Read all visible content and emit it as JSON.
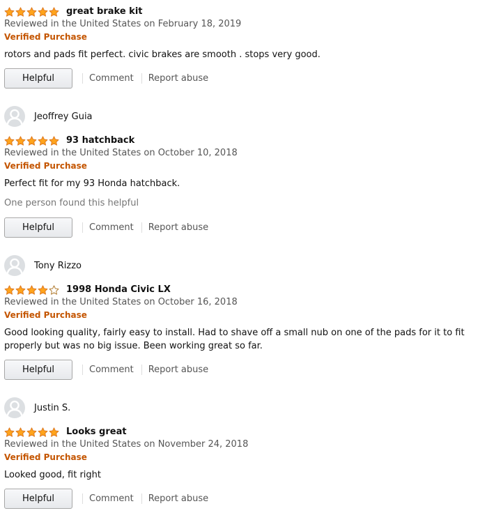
{
  "colors": {
    "star_fill": "#FFA41C",
    "star_stroke": "#DE7921",
    "verified": "#C45500",
    "button_border": "#A6A6A6"
  },
  "actions": {
    "helpful_label": "Helpful",
    "comment_label": "Comment",
    "report_label": "Report abuse"
  },
  "reviews": [
    {
      "reviewer": "",
      "rating": 5,
      "title": "great brake kit",
      "date": "Reviewed in the United States on February 18, 2019",
      "verified": "Verified Purchase",
      "body": "rotors and pads fit perfect. civic brakes are smooth . stops very good.",
      "helpful_count": ""
    },
    {
      "reviewer": "Jeoffrey Guia",
      "rating": 5,
      "title": "93 hatchback",
      "date": "Reviewed in the United States on October 10, 2018",
      "verified": "Verified Purchase",
      "body": "Perfect fit for my 93 Honda hatchback.",
      "helpful_count": "One person found this helpful"
    },
    {
      "reviewer": "Tony Rizzo",
      "rating": 4,
      "title": "1998 Honda Civic LX",
      "date": "Reviewed in the United States on October 16, 2018",
      "verified": "Verified Purchase",
      "body": "Good looking quality, fairly easy to install. Had to shave off a small nub on one of the pads for it to fit properly but was no big issue. Been working great so far.",
      "helpful_count": ""
    },
    {
      "reviewer": "Justin S.",
      "rating": 5,
      "title": "Looks great",
      "date": "Reviewed in the United States on November 24, 2018",
      "verified": "Verified Purchase",
      "body": "Looked good, fit right",
      "helpful_count": ""
    }
  ]
}
